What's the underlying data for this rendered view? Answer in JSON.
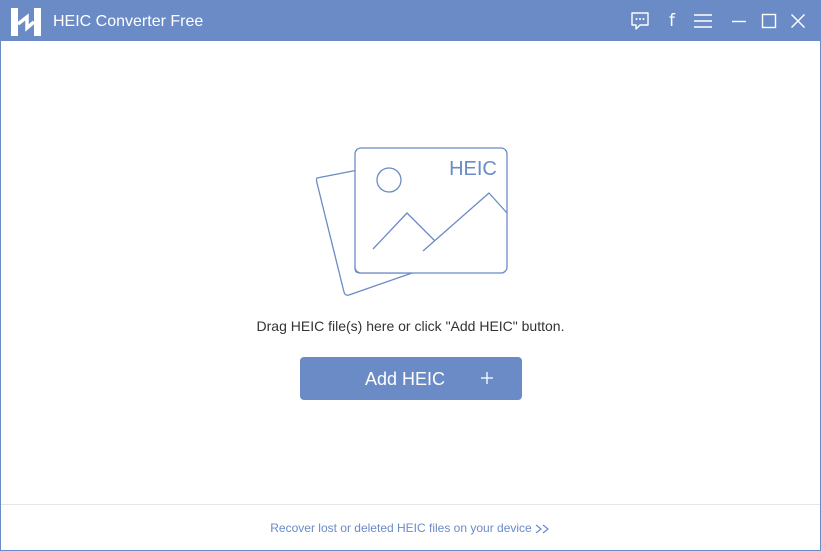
{
  "window": {
    "title": "HEIC Converter Free"
  },
  "titlebar_icons": [
    "logo-icon",
    "feedback-icon",
    "facebook-icon",
    "menu-icon",
    "minimize-icon",
    "maximize-icon",
    "close-icon"
  ],
  "titlebar": {
    "facebook_glyph": "f"
  },
  "main": {
    "illustration_badge": "HEIC",
    "drop_hint": "Drag HEIC file(s) here or click \"Add HEIC\" button.",
    "add_button_label": "Add HEIC"
  },
  "footer": {
    "recover_link": "Recover lost or deleted HEIC files on your device"
  },
  "colors": {
    "accent": "#6a8bc6",
    "text": "#333333",
    "background": "#ffffff"
  }
}
